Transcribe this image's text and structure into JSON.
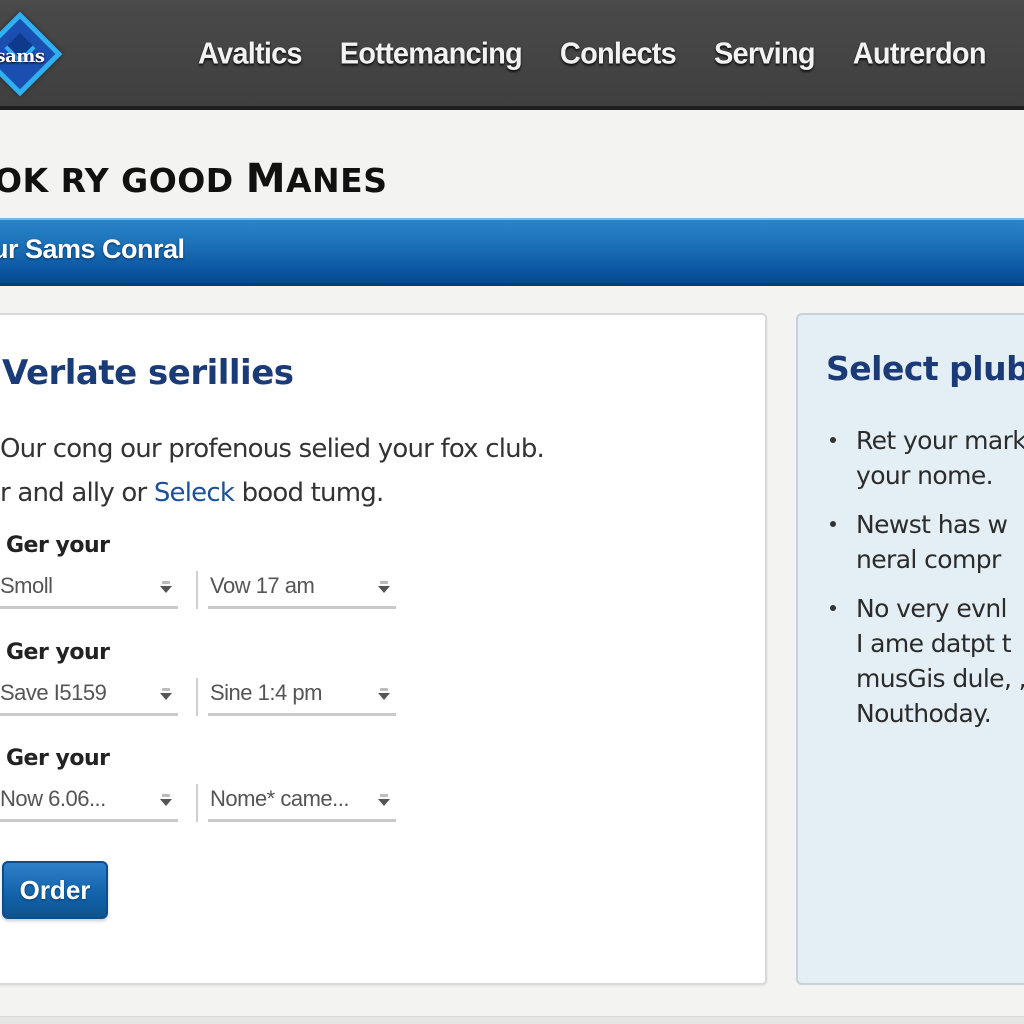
{
  "logo": {
    "text": "sams",
    "icon": "sams-club-diamond-logo"
  },
  "nav": {
    "items": [
      {
        "label": "Avaltics"
      },
      {
        "label": "Eottemancing"
      },
      {
        "label": "Conlects"
      },
      {
        "label": "Serving"
      },
      {
        "label": "Autrerdon"
      }
    ]
  },
  "page": {
    "heading_small": "OK RY GOOD ",
    "heading_big": "M",
    "heading_rest": "ANES"
  },
  "banner": {
    "text": "ur Sams Conral"
  },
  "main_card": {
    "title": "Verlate serillies",
    "description_line1": "Our cong our profenous selied your fox club.",
    "description_line2_pre": "r and ally or ",
    "description_link": "Seleck",
    "description_line2_post": " bood tumg.",
    "fields": [
      {
        "label": "Ger your",
        "select_a": "Smoll",
        "select_b": "Vow 17 am"
      },
      {
        "label": "Ger your",
        "select_a": "Save I5159",
        "select_b": "Sine 1:4 pm"
      },
      {
        "label": "Ger your",
        "select_a": "Now 6.06...",
        "select_b": "Nome* came..."
      }
    ],
    "order_button": "Order"
  },
  "side_panel": {
    "title": "Select plub",
    "bullets": [
      {
        "lines": [
          "Ret your mark",
          "your nome."
        ]
      },
      {
        "lines": [
          "Newst has w",
          "neral compr"
        ]
      },
      {
        "lines": [
          "No very evnl",
          "I ame datpt t",
          "musGis dule, ,",
          "Nouthoday."
        ]
      }
    ]
  },
  "colors": {
    "topbar": "#444444",
    "banner_blue": "#1a6db4",
    "title_blue": "#1b3a78",
    "link_blue": "#1c4f9c",
    "button_blue": "#1262aa",
    "panel_bg": "#e3eef5"
  }
}
